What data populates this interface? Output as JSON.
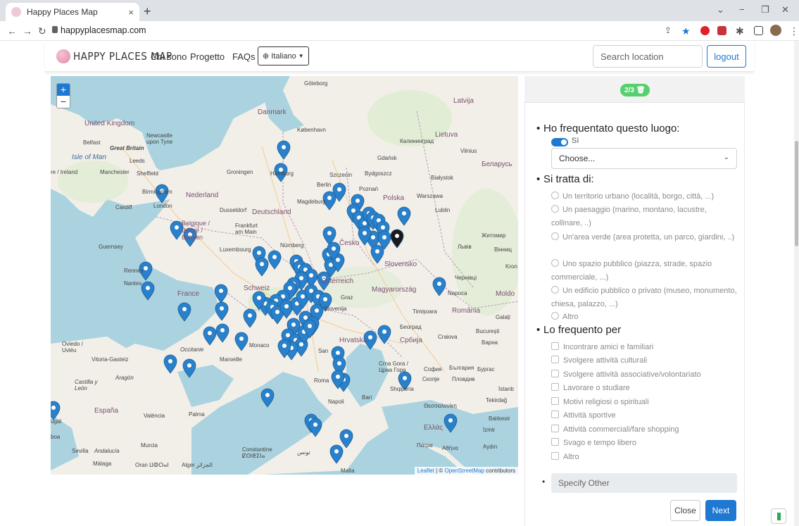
{
  "browser": {
    "tab_title": "Happy Places Map",
    "tab_close": "×",
    "new_tab": "+",
    "url": "happyplacesmap.com"
  },
  "navbar": {
    "brand": "HAPPY PLACES MAP",
    "links": [
      "Chi sono",
      "Progetto",
      "FAQs"
    ],
    "language": "Italiano",
    "search_placeholder": "Search location",
    "logout": "logout"
  },
  "map": {
    "zoom_in": "+",
    "zoom_out": "−",
    "attribution_leaflet": "Leaflet",
    "attribution_sep": " | © ",
    "attribution_osm": "OpenStreetMap",
    "attribution_rest": " contributors",
    "labels": {
      "united_kingdom": "United Kingdom",
      "great_britain": "Great Britain",
      "ireland": "re / Ireland",
      "belfast": "Belfast",
      "isle_of_man": "Isle of Man",
      "leeds": "Leeds",
      "manchester": "Manchester",
      "sheffield": "Sheffield",
      "birmingham": "Birmingham",
      "cardiff": "Cardiff",
      "london": "London",
      "newcastle": "Newcastle upon Tyne",
      "guernsey": "Guernsey",
      "danmark": "Danmark",
      "kobenhavn": "København",
      "goteborg": "Göteborg",
      "nederland": "Nederland",
      "groningen": "Groningen",
      "hamburg": "Hamburg",
      "deutschland": "Deutschland",
      "berlin": "Berlin",
      "magdeburg": "Magdeburg",
      "dusseldorf": "Dusseldorf",
      "frankfurt": "Frankfurt am Main",
      "nurnberg": "Nürnberg",
      "luxembourg": "Luxembourg",
      "belgique": "Belgique / België / Belgien",
      "france": "France",
      "rennes": "Rennes",
      "nantes": "Nantes",
      "schweiz": "Schweiz",
      "osterreich": "Österreich",
      "polska": "Polska",
      "poznan": "Poznań",
      "warszawa": "Warszawa",
      "lublin": "Lublin",
      "gdansk": "Gdańsk",
      "szczecin": "Szczecin",
      "bydgoszcz": "Bydgoszcz",
      "bialystok": "Białystok",
      "kaliningrad": "Калининград",
      "lietuva": "Lietuva",
      "vilnius": "Vilnius",
      "latvija": "Latvija",
      "belarus": "Беларусь",
      "ceska": "Česko",
      "slovensko": "Slovensko",
      "magyarorszag": "Magyarország",
      "romania": "România",
      "timisoara": "Timișoara",
      "craiova": "Craiova",
      "bucuresti": "București",
      "srbija": "Србија",
      "beograd": "Београд",
      "hrvatska": "Hrvatska",
      "slovenija": "Slovenija",
      "graz": "Graz",
      "crna_gora": "Crna Gora / Црна Гора",
      "sofia": "София",
      "bulgaria": "България",
      "skopje": "Скопје",
      "shqiperia": "Shqipëria",
      "ellas": "Ελλάς",
      "athina": "Αθήνα",
      "patra": "Πάτρα",
      "izmir": "İzmir",
      "aydin": "Aydın",
      "istanbul": "İstanb",
      "tekirdag": "Tekirdağ",
      "balikesir": "Balıkesir",
      "roma": "Roma",
      "napoli": "Napoli",
      "bari": "Bari",
      "san_marino": "San",
      "monaco": "Monaco",
      "marseille": "Marseille",
      "occitanie": "Occitanie",
      "espana": "España",
      "vitoria": "Vitoria-Gasteiz",
      "oviedo": "Oviedo / Uviéu",
      "valencia": "València",
      "palma": "Palma",
      "murcia": "Murcia",
      "sevilla": "Sevilla",
      "malaga": "Málaga",
      "algeria_oran": "Oran ⵡⵀⵔⴰⵏ",
      "alger": "Alger الجزائر",
      "constantine": "Constantine ⵇⵙⵏⵟⵉⵏⴰ",
      "tunis": "تونس",
      "malta": "Malta",
      "lisboa": "boa",
      "portugal": "ugal",
      "kron": "Kron",
      "moldo": "Moldo",
      "galati": "Galați",
      "chernivtsi": "Чернівці",
      "lviv": "Львів",
      "zhytomyr": "Житомир",
      "vinnytsia": "Вінниц",
      "napoca": "Napoca",
      "varna": "Варна",
      "burgas": "Бургас",
      "plovdiv": "Пловдив",
      "thessaloniki": "Θεσσαλονίκη",
      "aragon": "Aragón",
      "castilla": "Castilla y León",
      "andalucia": "Andalucía"
    }
  },
  "panel": {
    "step": "2/3",
    "q1_title": "Ho frequentato questo luogo:",
    "q1_toggle_label": "Sì",
    "q1_select": "Choose...",
    "q2_title": "Si tratta di:",
    "q2_options": [
      "Un territorio urbano (località, borgo, città, ...)",
      "Un paesaggio (marino, montano, lacustre, collinare, ..)",
      "Un'area verde (area protetta, un parco, giardini, ..)",
      "Uno spazio pubblico (piazza, strade, spazio commerciale, ...)",
      "Un edificio pubblico o privato (museo, monumento, chiesa, palazzo, ...)",
      "Altro"
    ],
    "q3_title": "Lo frequento per",
    "q3_options": [
      "Incontrare amici e familiari",
      "Svolgere attività culturali",
      "Svolgere attività associative/volontariato",
      "Lavorare o studiare",
      "Motivi religiosi o spirituali",
      "Attività sportive",
      "Attività commerciali/fare shopping",
      "Svago e tempo libero",
      "Altro"
    ],
    "other_placeholder": "Specify Other",
    "close": "Close",
    "next": "Next"
  },
  "colors": {
    "accent": "#1f78d1",
    "badge": "#55d06f",
    "marker": "#2a81cb"
  }
}
